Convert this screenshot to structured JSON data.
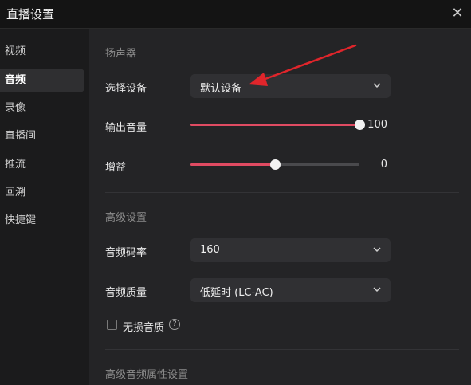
{
  "window": {
    "title": "直播设置",
    "close_icon": "close-icon"
  },
  "sidebar": {
    "items": [
      {
        "label": "视频",
        "active": false
      },
      {
        "label": "音频",
        "active": true
      },
      {
        "label": "录像",
        "active": false
      },
      {
        "label": "直播间",
        "active": false
      },
      {
        "label": "推流",
        "active": false
      },
      {
        "label": "回溯",
        "active": false
      },
      {
        "label": "快捷键",
        "active": false
      }
    ]
  },
  "speaker": {
    "section_title": "扬声器",
    "device_label": "选择设备",
    "device_value": "默认设备",
    "volume_label": "输出音量",
    "volume_value": "100",
    "volume_level": 1.0,
    "gain_label": "增益",
    "gain_value": "0",
    "gain_level": 0.5
  },
  "advanced": {
    "section_title": "高级设置",
    "bitrate_label": "音频码率",
    "bitrate_value": "160",
    "quality_label": "音频质量",
    "quality_value": "低延时 (LC-AC)",
    "lossless_label": "无损音质",
    "lossless_checked": false
  },
  "advanced_props": {
    "section_title": "高级音频属性设置"
  },
  "colors": {
    "accent": "#e04b62",
    "annotation_arrow": "#e0252b"
  }
}
